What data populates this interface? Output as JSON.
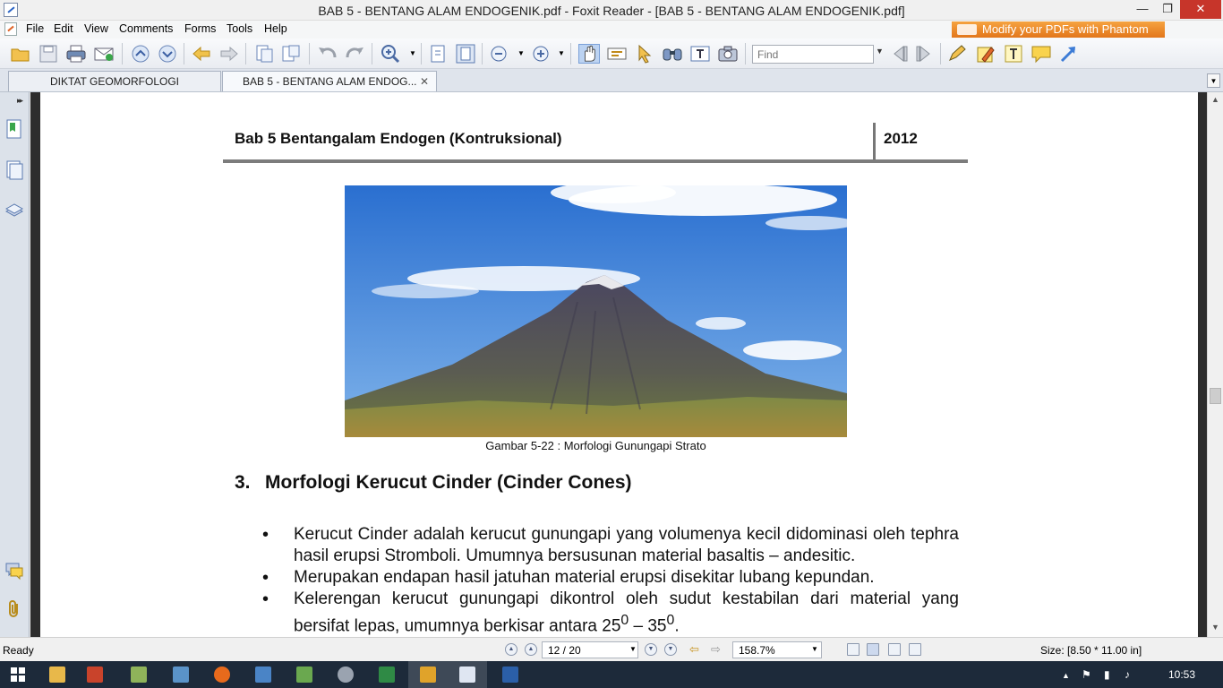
{
  "window": {
    "title": "BAB 5 - BENTANG ALAM ENDOGENIK.pdf - Foxit Reader - [BAB 5 - BENTANG ALAM ENDOGENIK.pdf]",
    "min_glyph": "—",
    "max_glyph": "❐",
    "close_glyph": "✕"
  },
  "menu": {
    "items": [
      "File",
      "Edit",
      "View",
      "Comments",
      "Forms",
      "Tools",
      "Help"
    ],
    "promo": "Modify your PDFs with Phantom"
  },
  "toolbar": {
    "find_placeholder": "Find"
  },
  "tabs": [
    {
      "label": "DIKTAT GEOMORFOLOGI",
      "active": false
    },
    {
      "label": "BAB 5 - BENTANG ALAM ENDOG...",
      "active": true,
      "close": "✕"
    }
  ],
  "document": {
    "header_left": "Bab 5 Bentangalam Endogen (Kontruksional)",
    "header_right": "2012",
    "figure_caption": "Gambar 5-22 : Morfologi Gunungapi Strato",
    "section_number": "3.",
    "section_title": "Morfologi Kerucut Cinder (Cinder Cones)",
    "bullets": [
      {
        "text": "Kerucut Cinder adalah kerucut gunungapi yang volumenya kecil didominasi oleh tephra hasil erupsi Stromboli. Umumnya bersusunan material basaltis – andesitic."
      },
      {
        "text": "Merupakan endapan hasil jatuhan material erupsi disekitar lubang kepundan."
      },
      {
        "text_before": "Kelerengan kerucut gunungapi dikontrol oleh sudut kestabilan dari material yang bersifat lepas, umumnya berkisar antara 25",
        "sup1": "0",
        "middle": " – 35",
        "sup2": "0",
        "text_after": "."
      }
    ]
  },
  "status": {
    "ready": "Ready",
    "page": "12 / 20",
    "zoom": "158.7%",
    "size": "Size: [8.50 * 11.00 in]"
  },
  "taskbar": {
    "clock": "10:53"
  },
  "colors": {
    "accent": "#e2761b",
    "close_red": "#c7352a",
    "taskbar": "#1d2a3a"
  }
}
